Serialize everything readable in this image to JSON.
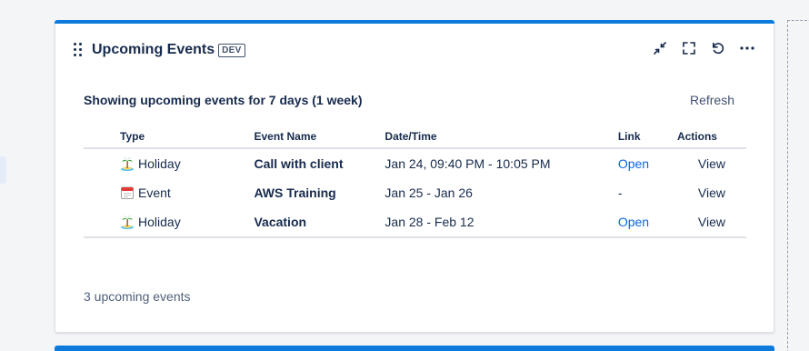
{
  "widget": {
    "title": "Upcoming Events",
    "badge": "DEV",
    "toolbar": {
      "collapse_icon": "minimize-arrows-icon",
      "fullscreen_icon": "fullscreen-icon",
      "refresh_icon": "reload-icon",
      "more_icon": "more-horizontal-icon"
    },
    "summary": "Showing upcoming events for 7 days (1 week)",
    "refresh_label": "Refresh",
    "columns": [
      "Type",
      "Event Name",
      "Date/Time",
      "Link",
      "Actions"
    ],
    "rows": [
      {
        "type_icon": "island-icon",
        "type": "Holiday",
        "name": "Call with client",
        "date": "Jan 24, 09:40 PM - 10:05 PM",
        "link": "Open",
        "action": "View"
      },
      {
        "type_icon": "calendar-icon",
        "type": "Event",
        "name": "AWS Training",
        "date": "Jan 25 - Jan 26",
        "link": "-",
        "action": "View"
      },
      {
        "type_icon": "island-icon",
        "type": "Holiday",
        "name": "Vacation",
        "date": "Jan 28 - Feb 12",
        "link": "Open",
        "action": "View"
      }
    ],
    "footer": "3 upcoming events",
    "colors": {
      "accent": "#0c7bdc",
      "link": "#0c66e4"
    }
  }
}
